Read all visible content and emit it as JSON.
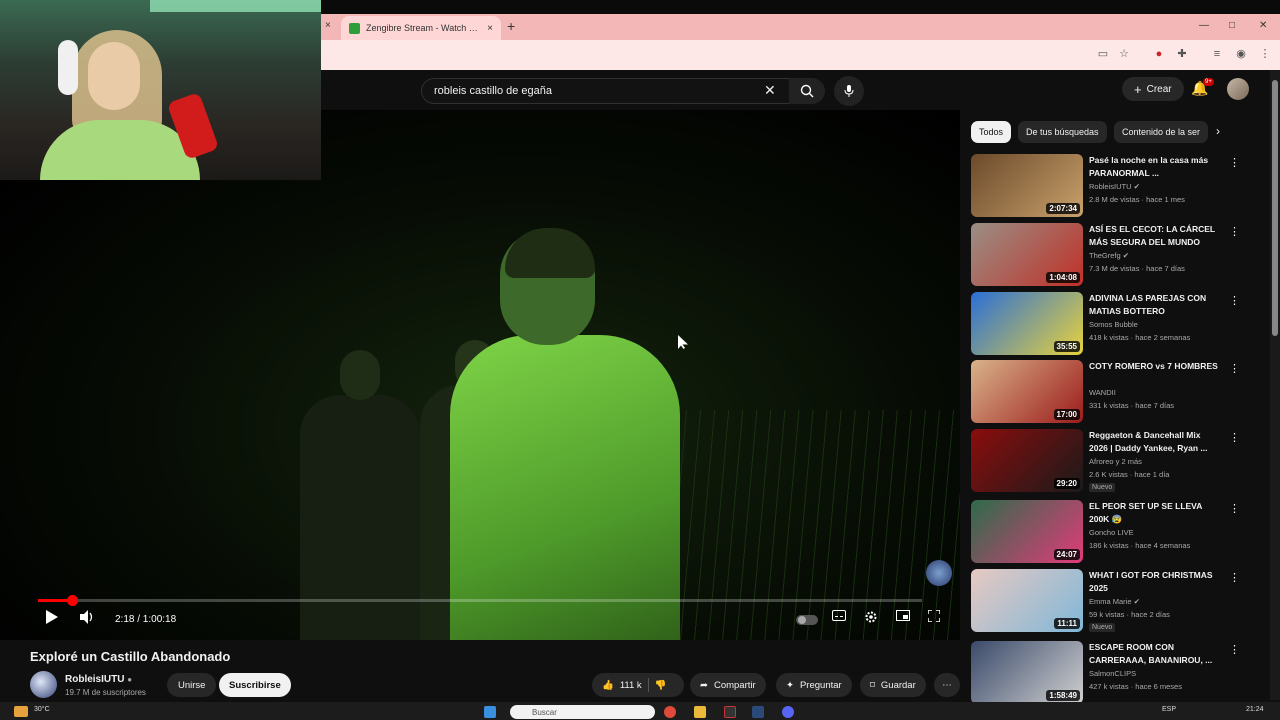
{
  "browser": {
    "tab_title": "Zengibre Stream - Watch Live o",
    "tab_close": "×",
    "new_tab": "+",
    "left_close": "×",
    "window_controls": [
      "—",
      "□",
      "✕"
    ]
  },
  "youtube_header": {
    "search_value": "robleis castillo de egaña",
    "clear_icon": "✕",
    "create_label": "Crear",
    "notification_count": "9+"
  },
  "player": {
    "current_time": "2:18",
    "duration": "1:00:18",
    "time_display": "2:18 / 1:00:18",
    "progress_fraction": 0.038
  },
  "video": {
    "title": "Exploré un Castillo Abandonado",
    "channel": "RobleisIUTU",
    "subscribers": "19.7 M de suscriptores",
    "join_label": "Unirse",
    "subscribe_label": "Suscribirse",
    "likes": "111 k",
    "share_label": "Compartir",
    "ask_label": "Preguntar",
    "save_label": "Guardar"
  },
  "chips": [
    "Todos",
    "De tus búsquedas",
    "Contenido de la ser"
  ],
  "recommendations": [
    {
      "title": "Pasé la noche en la casa más PARANORMAL ...",
      "channel": "RobleisIUTU ✔",
      "meta": "2.8 M de vistas · hace 1 mes",
      "duration": "2:07:34",
      "badge": "",
      "colors": [
        "#6b4a2b",
        "#c9a16b"
      ]
    },
    {
      "title": "ASÍ ES EL CECOT: LA CÁRCEL MÁS SEGURA DEL MUNDO",
      "channel": "TheGrefg ✔",
      "meta": "7.3 M de vistas · hace 7 días",
      "duration": "1:04:08",
      "badge": "",
      "colors": [
        "#9a8f86",
        "#c03028"
      ]
    },
    {
      "title": "ADIVINA LAS PAREJAS CON MATIAS BOTTERO",
      "channel": "Somos Bubble",
      "meta": "418 k vistas · hace 2 semanas",
      "duration": "35:55",
      "badge": "",
      "colors": [
        "#2a6fd6",
        "#e8d23c"
      ]
    },
    {
      "title": "COTY ROMERO vs 7 HOMBRES",
      "channel": "WANDII",
      "meta": "331 k vistas · hace 7 días",
      "duration": "17:00",
      "badge": "",
      "colors": [
        "#d9b38a",
        "#9c1b1b"
      ]
    },
    {
      "title": "Reggaeton & Dancehall Mix 2026 | Daddy Yankee, Ryan ...",
      "channel": "Afroreo y 2 más",
      "meta": "2.6 K vistas · hace 1 día",
      "duration": "29:20",
      "badge": "Nuevo",
      "colors": [
        "#8b0d0d",
        "#1a1a1a"
      ]
    },
    {
      "title": "EL PEOR SET UP SE LLEVA 200K 😰",
      "channel": "Goncho LIVE",
      "meta": "186 k vistas · hace 4 semanas",
      "duration": "24:07",
      "badge": "",
      "colors": [
        "#2d6b4a",
        "#e23b7a"
      ]
    },
    {
      "title": "WHAT I GOT FOR CHRISTMAS 2025",
      "channel": "Emma Marie ✔",
      "meta": "59 k vistas · hace 2 días",
      "duration": "11:11",
      "badge": "Nuevo",
      "colors": [
        "#e7c9c2",
        "#7fb7d8"
      ]
    },
    {
      "title": "ESCAPE ROOM CON CARRERAAA, BANANIROU, ...",
      "channel": "SalmonCLIPS",
      "meta": "427 k vistas · hace 6 meses",
      "duration": "1:58:49",
      "badge": "",
      "colors": [
        "#3a4a6a",
        "#d0d0d0"
      ]
    }
  ],
  "taskbar": {
    "weather": "30°C",
    "search_placeholder": "Buscar",
    "lang": "ESP",
    "time": "21:24"
  }
}
